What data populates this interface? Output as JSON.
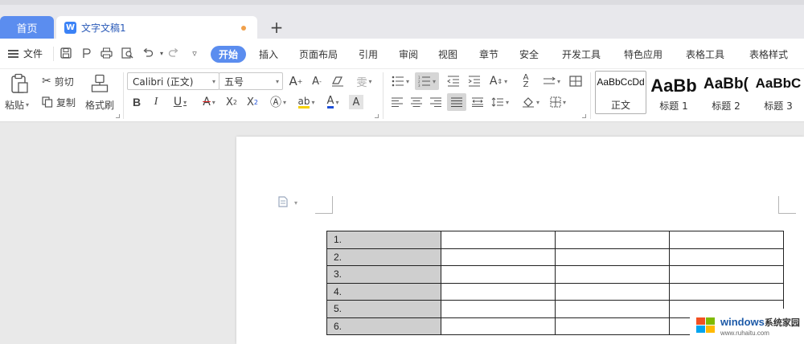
{
  "tabs": {
    "home": "首页",
    "document": "文字文稿1",
    "doc_icon": "W",
    "add": "+"
  },
  "menu": {
    "file": "文件",
    "items": [
      "开始",
      "插入",
      "页面布局",
      "引用",
      "审阅",
      "视图",
      "章节",
      "安全",
      "开发工具",
      "特色应用",
      "表格工具",
      "表格样式"
    ]
  },
  "ribbon": {
    "paste": "粘贴",
    "cut": "剪切",
    "copy": "复制",
    "format_painter": "格式刷",
    "font_name": "Calibri (正文)",
    "font_size": "五号",
    "styles": [
      {
        "sample": "AaBbCcDd",
        "name": "正文"
      },
      {
        "sample": "AaBb",
        "name": "标题 1"
      },
      {
        "sample": "AaBb(",
        "name": "标题 2"
      },
      {
        "sample": "AaBbC",
        "name": "标题 3"
      }
    ]
  },
  "table": {
    "rows": [
      "1.",
      "2.",
      "3.",
      "4.",
      "5.",
      "6."
    ]
  },
  "watermark": {
    "main": "windows",
    "suffix": "系统家园",
    "url": "www.ruhaitu.com"
  },
  "colors": {
    "accent": "#5b8def",
    "first_column_fill": "#cfcfcf",
    "highlight_yellow": "#f5d000",
    "font_red": "#e02020",
    "font_blue": "#1d4ed8"
  }
}
